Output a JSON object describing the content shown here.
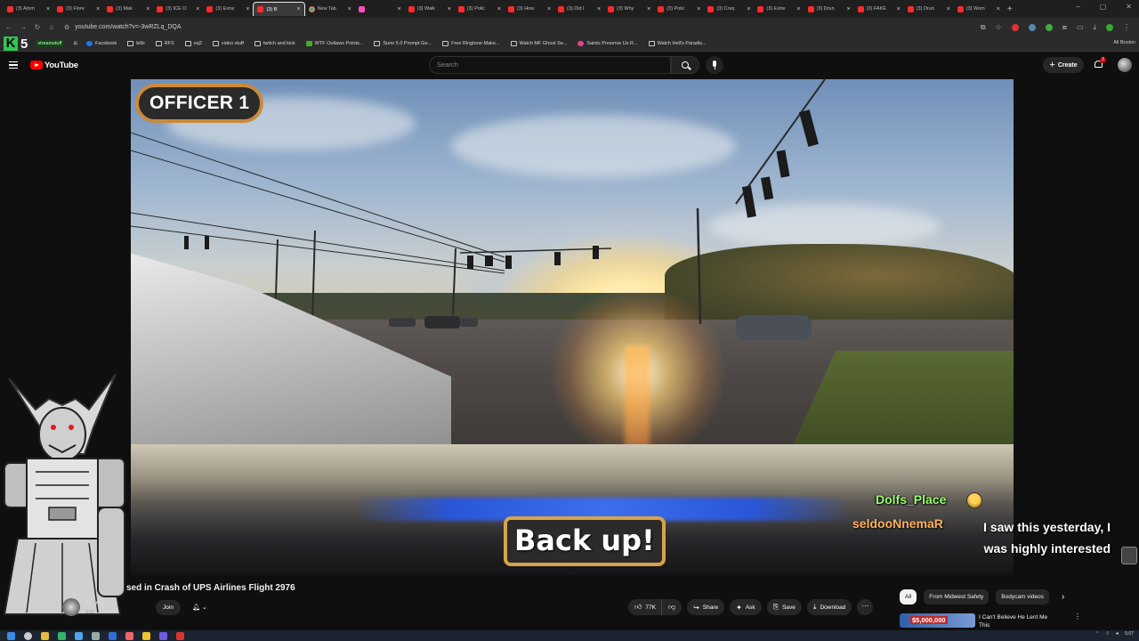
{
  "browser": {
    "tabs": [
      {
        "label": "(3) Amm",
        "icon": "youtube-icon"
      },
      {
        "label": "(3) Flore",
        "icon": "youtube-icon"
      },
      {
        "label": "(3) Mak",
        "icon": "youtube-icon"
      },
      {
        "label": "(3) ICE O",
        "icon": "youtube-icon"
      },
      {
        "label": "(3) Extre",
        "icon": "youtube-icon"
      },
      {
        "label": "(3) B",
        "icon": "youtube-icon",
        "active": true
      },
      {
        "label": "New Tab",
        "icon": "chrome-icon"
      },
      {
        "label": "",
        "icon": "pink-icon"
      },
      {
        "label": "(3) Walk",
        "icon": "youtube-icon"
      },
      {
        "label": "(3) Polic",
        "icon": "youtube-icon"
      },
      {
        "label": "(3) How",
        "icon": "youtube-icon"
      },
      {
        "label": "(3) Did I",
        "icon": "youtube-icon"
      },
      {
        "label": "(3) Why",
        "icon": "youtube-icon"
      },
      {
        "label": "(3) Polic",
        "icon": "youtube-icon"
      },
      {
        "label": "(3) Creq",
        "icon": "youtube-icon"
      },
      {
        "label": "(3) Extre",
        "icon": "youtube-icon"
      },
      {
        "label": "(3) Drun",
        "icon": "youtube-icon"
      },
      {
        "label": "(3) FAKE",
        "icon": "youtube-icon"
      },
      {
        "label": "(3) Drun",
        "icon": "youtube-icon"
      },
      {
        "label": "(3) Wom",
        "icon": "youtube-icon"
      }
    ],
    "url": "youtube.com/watch?v=-3wRZLq_DQA",
    "bookmarks_brand": {
      "k": "K",
      "n": "5",
      "tag": "streamstuff"
    },
    "bookmarks": [
      {
        "label": "Facebook",
        "icon": "facebook-icon"
      },
      {
        "label": "bills",
        "icon": "folder-icon"
      },
      {
        "label": "RFS",
        "icon": "folder-icon"
      },
      {
        "label": "eq2",
        "icon": "folder-icon"
      },
      {
        "label": "video stuff",
        "icon": "folder-icon"
      },
      {
        "label": "twitch and kick",
        "icon": "folder-icon"
      },
      {
        "label": "WTF Outlaws Points...",
        "icon": "green-icon"
      },
      {
        "label": "Suno 5.0 Prompt Ge...",
        "icon": "gear-icon"
      },
      {
        "label": "Free Ringtone Make...",
        "icon": "doc-icon"
      },
      {
        "label": "Watch MF Ghost Se...",
        "icon": "fox-icon"
      },
      {
        "label": "Saints Preserve Us R...",
        "icon": "pink-icon"
      },
      {
        "label": "Watch Hell's Paradis...",
        "icon": "fox-icon"
      }
    ],
    "all_bookmarks": "All Bookm"
  },
  "youtube": {
    "logo_text": "YouTube",
    "search_placeholder": "Search",
    "create_label": "Create",
    "notification_count": "3"
  },
  "video": {
    "overlay_top_left": "OFFICER 1",
    "subtitle": "Back up!"
  },
  "chat": [
    {
      "user": "Dolfs_Place",
      "user_color": "#9bff6e",
      "message": ""
    },
    {
      "user": "seldooNnemaR",
      "user_color": "#ffb15a",
      "message_lines": [
        "I saw this yesterday, I",
        "was highly interested"
      ]
    }
  ],
  "below_video": {
    "title_visible": "sed in Crash of UPS Airlines Flight 2976",
    "channel_name": "M...ety",
    "channel_subs": "3.51",
    "join_label": "Join",
    "like_count": "77K",
    "share_label": "Share",
    "ask_label": "Ask",
    "save_label": "Save",
    "download_label": "Download"
  },
  "recommendations": {
    "chips": [
      "All",
      "From Midwest Safety",
      "Bodycam videos"
    ],
    "first_item": {
      "price_badge": "$5,000,000",
      "title": "I Can't Believe He Lent Me This"
    }
  },
  "taskbar": {
    "time": "5:07",
    "date": ""
  }
}
